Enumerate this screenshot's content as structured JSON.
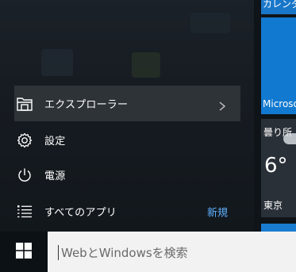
{
  "menu": {
    "explorer": {
      "label": "エクスプローラー",
      "icon": "file-explorer-icon"
    },
    "settings": {
      "label": "設定",
      "icon": "gear-icon"
    },
    "power": {
      "label": "電源",
      "icon": "power-icon"
    },
    "all_apps": {
      "label": "すべてのアプリ",
      "icon": "list-icon",
      "badge": "新規"
    }
  },
  "tiles": {
    "calendar_label": "カレンダー",
    "mail_label": "Microsoft",
    "weather": {
      "condition": "曇り所",
      "temperature": "6°",
      "city": "東京"
    }
  },
  "taskbar": {
    "start_icon": "windows-logo-icon",
    "search_placeholder": "WebとWindowsを検索"
  },
  "colors": {
    "accent": "#1279d0",
    "badge": "#5fb0ff",
    "hover_row": "#2e3338",
    "taskbar": "#0c1116",
    "search_box": "#f2f2f2"
  }
}
